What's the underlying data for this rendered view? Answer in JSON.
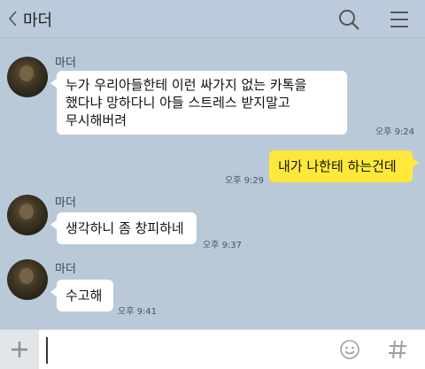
{
  "header": {
    "title": "마더",
    "back_icon": "chevron-left-icon",
    "search_icon": "search-icon",
    "menu_icon": "hamburger-menu-icon"
  },
  "messages": [
    {
      "sender": "마더",
      "text_lines": [
        "누가 우리아들한테 이런 싸가지 없는 카톡을",
        "했다냐  망하다니 아들 스트레스 받지말고",
        "무시해버려"
      ],
      "time": "오후 9:24"
    },
    {
      "mine": true,
      "text": "내가 나한테 하는건데",
      "time": "오후 9:29"
    },
    {
      "sender": "마더",
      "text": "생각하니 좀 창피하네",
      "time": "오후 9:37"
    },
    {
      "sender": "마더",
      "text": "수고해",
      "time": "오후 9:41"
    }
  ],
  "input": {
    "placeholder": "",
    "plus_icon": "plus-icon",
    "emoticon_icon": "smiley-icon",
    "sharp_icon": "hash-icon"
  },
  "colors": {
    "background": "#b9c9d8",
    "my_bubble": "#fee93a",
    "other_bubble": "#ffffff"
  }
}
